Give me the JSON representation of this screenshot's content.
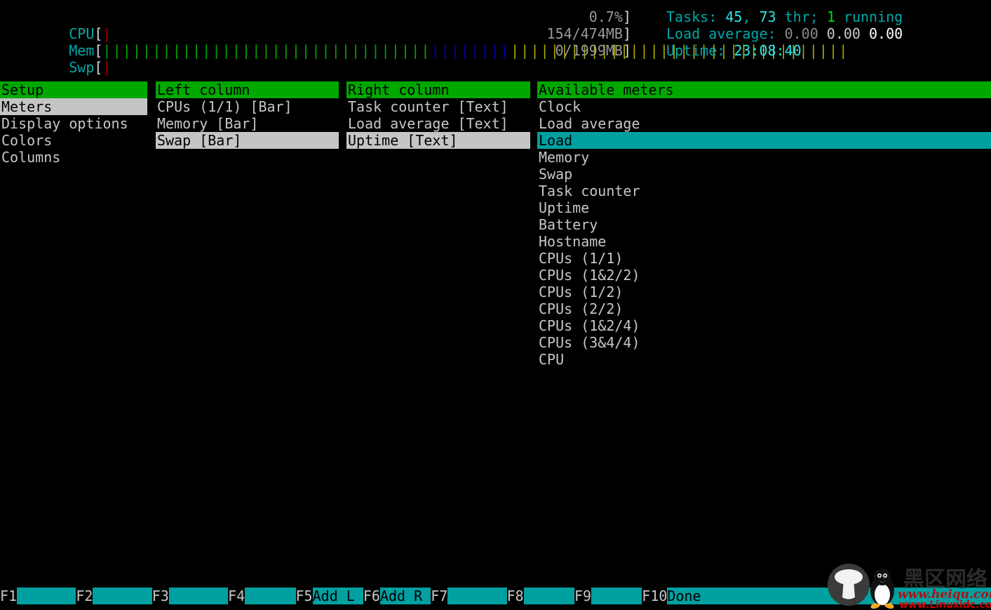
{
  "header": {
    "meters": [
      {
        "label": "CPU",
        "open": "[",
        "close": "]",
        "value": "0.7%",
        "pattern": "r..........................................................................."
      },
      {
        "label": "Mem",
        "open": "[",
        "close": "]",
        "value": "154/474MB",
        "pattern": "gggggggggggggggggggggggggggggggggbbbbbbbbyyyyyyyyyyyyyyyyyyyyyyyyyyyyyyyyyy"
      },
      {
        "label": "Swp",
        "open": "[",
        "close": "]",
        "value": "0/1999MB",
        "pattern": "r..........................................................................."
      }
    ],
    "stats": {
      "tasks_label": "Tasks: ",
      "tasks_count": "45",
      "tasks_sep": ", ",
      "threads_count": "73",
      "threads_label": " thr; ",
      "running_count": "1",
      "running_label": " running",
      "load_label": "Load average: ",
      "load1": "0.00",
      "load5": "0.00",
      "load15": "0.00",
      "uptime_label": "Uptime: ",
      "uptime_value": "23:08:40"
    }
  },
  "panels": {
    "setup": {
      "header": "Setup",
      "items": [
        {
          "label": "Meters",
          "state": "sel-gray"
        },
        {
          "label": "Display options",
          "state": "plain"
        },
        {
          "label": "Colors",
          "state": "plain"
        },
        {
          "label": "Columns",
          "state": "plain"
        }
      ]
    },
    "left_column": {
      "header": "Left column",
      "items": [
        {
          "label": "CPUs (1/1) [Bar]",
          "state": "plain"
        },
        {
          "label": "Memory [Bar]",
          "state": "plain"
        },
        {
          "label": "Swap [Bar]",
          "state": "sel-gray"
        }
      ]
    },
    "right_column": {
      "header": "Right column",
      "items": [
        {
          "label": "Task counter [Text]",
          "state": "plain"
        },
        {
          "label": "Load average [Text]",
          "state": "plain"
        },
        {
          "label": "Uptime [Text]",
          "state": "sel-gray"
        }
      ]
    },
    "available_meters": {
      "header": "Available meters",
      "items": [
        {
          "label": "Clock",
          "state": "plain"
        },
        {
          "label": "Load average",
          "state": "plain"
        },
        {
          "label": "Load",
          "state": "sel-cyan"
        },
        {
          "label": "Memory",
          "state": "plain"
        },
        {
          "label": "Swap",
          "state": "plain"
        },
        {
          "label": "Task counter",
          "state": "plain"
        },
        {
          "label": "Uptime",
          "state": "plain"
        },
        {
          "label": "Battery",
          "state": "plain"
        },
        {
          "label": "Hostname",
          "state": "plain"
        },
        {
          "label": "CPUs (1/1)",
          "state": "plain"
        },
        {
          "label": "CPUs (1&2/2)",
          "state": "plain"
        },
        {
          "label": "CPUs (1/2)",
          "state": "plain"
        },
        {
          "label": "CPUs (2/2)",
          "state": "plain"
        },
        {
          "label": "CPUs (1&2/4)",
          "state": "plain"
        },
        {
          "label": "CPUs (3&4/4)",
          "state": "plain"
        },
        {
          "label": "CPU",
          "state": "plain"
        }
      ]
    }
  },
  "function_bar": [
    {
      "key": "F1",
      "label": "       "
    },
    {
      "key": "F2",
      "label": "       "
    },
    {
      "key": "F3",
      "label": "       "
    },
    {
      "key": "F4",
      "label": "      "
    },
    {
      "key": "F5",
      "label": "Add L "
    },
    {
      "key": "F6",
      "label": "Add R "
    },
    {
      "key": "F7",
      "label": "       "
    },
    {
      "key": "F8",
      "label": "      "
    },
    {
      "key": "F9",
      "label": "      "
    },
    {
      "key": "F10",
      "label": "Done                                     "
    }
  ],
  "watermark": {
    "site_cn": "黑区网络",
    "url_1": "www.heiqu.com",
    "url_2": "www.Linuxidc.com"
  },
  "colors": {
    "accent_green": "#00a800",
    "accent_cyan": "#00a0a0",
    "selection_gray": "#c5c5c5",
    "bar_green": "#00a800",
    "bar_blue": "#0000c8",
    "bar_olive": "#a8a800",
    "bar_red": "#a80000",
    "text": "#c5c8c6",
    "background": "#000000"
  }
}
